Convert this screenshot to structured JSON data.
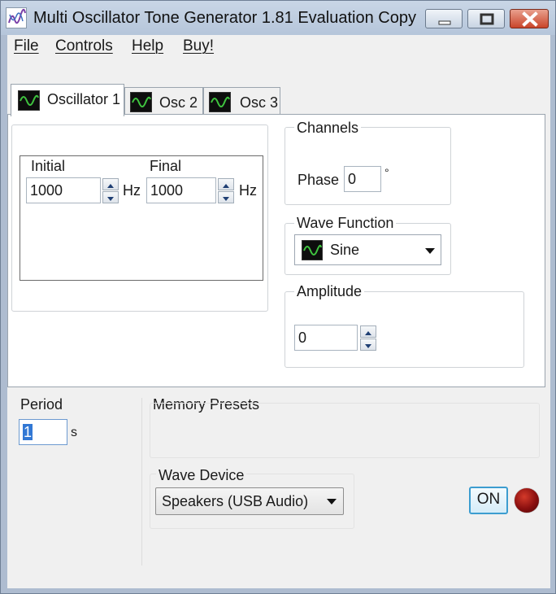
{
  "window": {
    "title": "Multi Oscillator Tone Generator 1.81 Evaluation Copy",
    "controls": [
      "minimize-icon",
      "maximize-icon",
      "close-icon"
    ]
  },
  "menu": {
    "items": [
      "File",
      "Controls",
      "Help",
      "Buy!"
    ]
  },
  "tabs": [
    {
      "label": "Oscillator 1",
      "icon": "sine-wave-icon",
      "active": true
    },
    {
      "label": "Osc 2",
      "icon": "sine-wave-icon",
      "active": false
    },
    {
      "label": "Osc 3",
      "icon": "sine-wave-icon",
      "active": false
    }
  ],
  "frequency": {
    "initial_label": "Initial",
    "initial_value": "1000",
    "final_label": "Final",
    "final_value": "1000",
    "unit": "Hz"
  },
  "channels": {
    "title": "Channels",
    "phase_label": "Phase",
    "phase_value": "0",
    "phase_unit": "°"
  },
  "wave_function": {
    "title": "Wave Function",
    "selected": "Sine",
    "icon": "sine-wave-icon"
  },
  "amplitude": {
    "title": "Amplitude",
    "value": "0"
  },
  "period": {
    "label": "Period",
    "value": "1",
    "unit": "s"
  },
  "memory_presets": {
    "title": "Memory Presets"
  },
  "wave_device": {
    "title": "Wave Device",
    "selected": "Speakers (USB Audio)"
  },
  "power": {
    "button_label": "ON",
    "indicator_color": "#8a0f0f"
  },
  "colors": {
    "button_focus": "#3c9dd0",
    "led": "#c0251a"
  }
}
